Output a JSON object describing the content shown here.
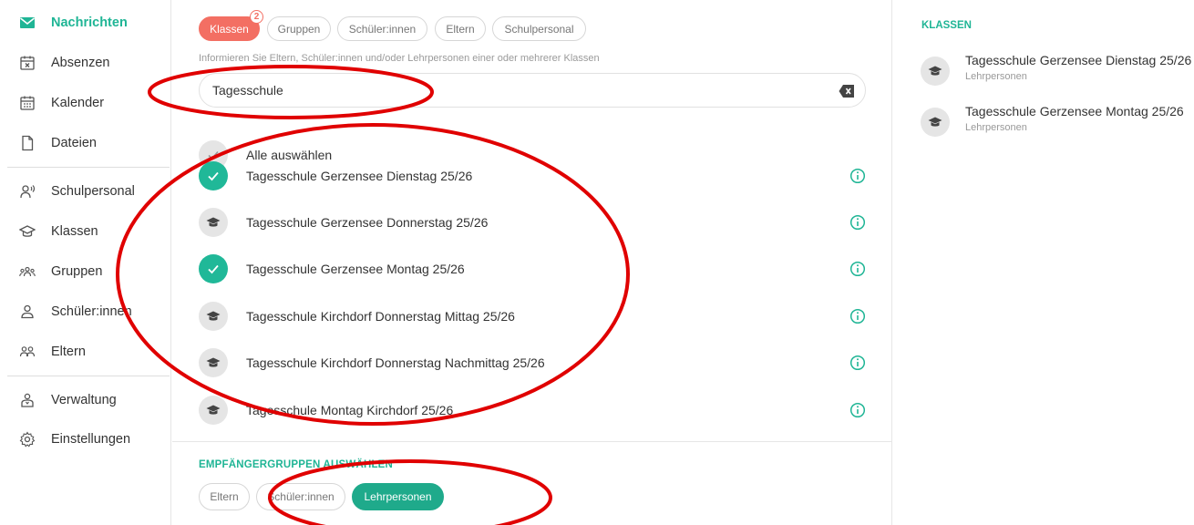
{
  "sidebar": {
    "items": [
      {
        "label": "Nachrichten",
        "icon": "mail-icon",
        "active": true
      },
      {
        "label": "Absenzen",
        "icon": "calendar-x-icon"
      },
      {
        "label": "Kalender",
        "icon": "calendar-icon"
      },
      {
        "label": "Dateien",
        "icon": "file-icon"
      },
      {
        "label": "Schulpersonal",
        "icon": "staff-icon"
      },
      {
        "label": "Klassen",
        "icon": "graduation-cap-icon"
      },
      {
        "label": "Gruppen",
        "icon": "group-icon"
      },
      {
        "label": "Schüler:innen",
        "icon": "student-icon"
      },
      {
        "label": "Eltern",
        "icon": "parents-icon"
      },
      {
        "label": "Verwaltung",
        "icon": "admin-icon"
      },
      {
        "label": "Einstellungen",
        "icon": "gear-icon"
      }
    ]
  },
  "tabs": {
    "items": [
      {
        "label": "Klassen",
        "active": true,
        "badge": "2"
      },
      {
        "label": "Gruppen"
      },
      {
        "label": "Schüler:innen"
      },
      {
        "label": "Eltern"
      },
      {
        "label": "Schulpersonal"
      }
    ]
  },
  "hint": "Informieren Sie Eltern, Schüler:innen und/oder Lehrpersonen einer oder mehrerer Klassen",
  "search": {
    "value": "Tagesschule"
  },
  "select_all": {
    "label": "Alle auswählen"
  },
  "classes": [
    {
      "name": "Tagesschule Gerzensee Dienstag 25/26",
      "selected": true
    },
    {
      "name": "Tagesschule Gerzensee Donnerstag 25/26",
      "selected": false
    },
    {
      "name": "Tagesschule Gerzensee Montag 25/26",
      "selected": true
    },
    {
      "name": "Tagesschule Kirchdorf Donnerstag Mittag 25/26",
      "selected": false
    },
    {
      "name": "Tagesschule Kirchdorf Donnerstag Nachmittag 25/26",
      "selected": false
    },
    {
      "name": "Tagesschule Montag Kirchdorf 25/26",
      "selected": false
    }
  ],
  "recipients": {
    "title": "EMPFÄNGERGRUPPEN AUSWÄHLEN",
    "groups": [
      {
        "label": "Eltern",
        "active": false
      },
      {
        "label": "Schüler:innen",
        "active": false
      },
      {
        "label": "Lehrpersonen",
        "active": true
      }
    ]
  },
  "right_panel": {
    "title": "KLASSEN",
    "selected": [
      {
        "name": "Tagesschule Gerzensee Dienstag 25/26",
        "role": "Lehrpersonen"
      },
      {
        "name": "Tagesschule Gerzensee Montag 25/26",
        "role": "Lehrpersonen"
      }
    ]
  },
  "colors": {
    "accent": "#1fb595",
    "active_tab": "#f36f63",
    "annotation": "#e00000"
  }
}
